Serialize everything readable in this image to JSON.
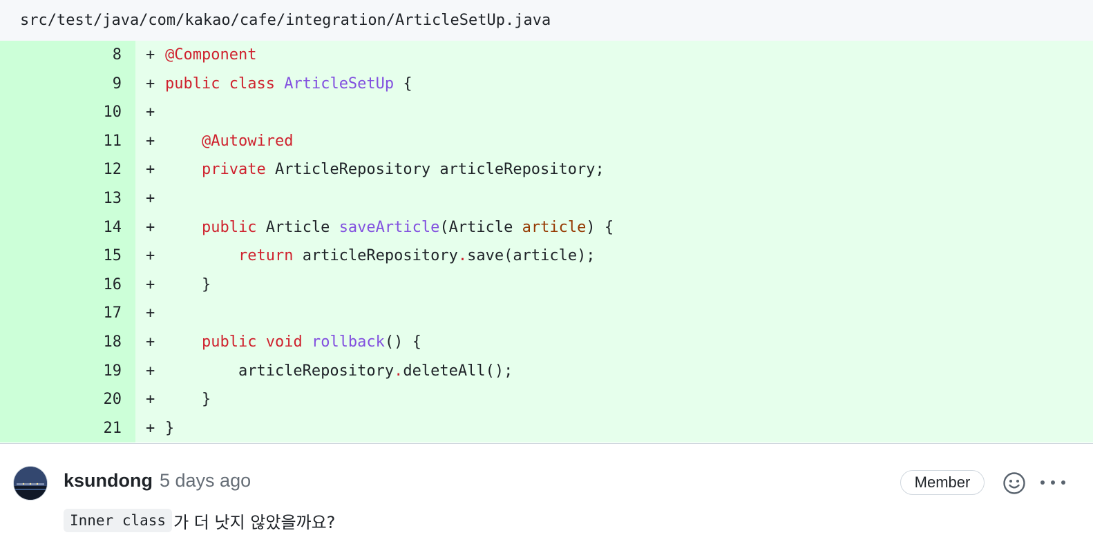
{
  "file": {
    "path": "src/test/java/com/kakao/cafe/integration/ArticleSetUp.java"
  },
  "diff": {
    "marker": "+",
    "lines": [
      {
        "number": "8",
        "tokens": [
          {
            "t": "@Component",
            "c": "ann"
          }
        ]
      },
      {
        "number": "9",
        "tokens": [
          {
            "t": "public",
            "c": "kw"
          },
          {
            "t": " "
          },
          {
            "t": "class",
            "c": "kw"
          },
          {
            "t": " "
          },
          {
            "t": "ArticleSetUp",
            "c": "fn"
          },
          {
            "t": " {"
          }
        ]
      },
      {
        "number": "10",
        "tokens": []
      },
      {
        "number": "11",
        "tokens": [
          {
            "t": "    "
          },
          {
            "t": "@Autowired",
            "c": "ann"
          }
        ]
      },
      {
        "number": "12",
        "tokens": [
          {
            "t": "    "
          },
          {
            "t": "private",
            "c": "kw"
          },
          {
            "t": " ArticleRepository articleRepository;"
          }
        ]
      },
      {
        "number": "13",
        "tokens": []
      },
      {
        "number": "14",
        "tokens": [
          {
            "t": "    "
          },
          {
            "t": "public",
            "c": "kw"
          },
          {
            "t": " Article "
          },
          {
            "t": "saveArticle",
            "c": "fn"
          },
          {
            "t": "(Article "
          },
          {
            "t": "article",
            "c": "param"
          },
          {
            "t": ") {"
          }
        ]
      },
      {
        "number": "15",
        "tokens": [
          {
            "t": "        "
          },
          {
            "t": "return",
            "c": "kw"
          },
          {
            "t": " articleRepository"
          },
          {
            "t": ".",
            "c": "dot"
          },
          {
            "t": "save(article);"
          }
        ]
      },
      {
        "number": "16",
        "tokens": [
          {
            "t": "    }"
          }
        ]
      },
      {
        "number": "17",
        "tokens": []
      },
      {
        "number": "18",
        "tokens": [
          {
            "t": "    "
          },
          {
            "t": "public",
            "c": "kw"
          },
          {
            "t": " "
          },
          {
            "t": "void",
            "c": "kw"
          },
          {
            "t": " "
          },
          {
            "t": "rollback",
            "c": "fn"
          },
          {
            "t": "() {"
          }
        ]
      },
      {
        "number": "19",
        "tokens": [
          {
            "t": "        articleRepository"
          },
          {
            "t": ".",
            "c": "dot"
          },
          {
            "t": "deleteAll();"
          }
        ]
      },
      {
        "number": "20",
        "tokens": [
          {
            "t": "    }"
          }
        ]
      },
      {
        "number": "21",
        "tokens": [
          {
            "t": "}"
          }
        ]
      }
    ]
  },
  "comment": {
    "author": "ksundong",
    "time": "5 days ago",
    "badge": "Member",
    "body_code": "Inner class",
    "body_text": "가 더 낫지 않았을까요?",
    "icons": {
      "reaction": "smiley-icon",
      "more": "kebab-horizontal-icon",
      "avatar": "avatar"
    }
  }
}
